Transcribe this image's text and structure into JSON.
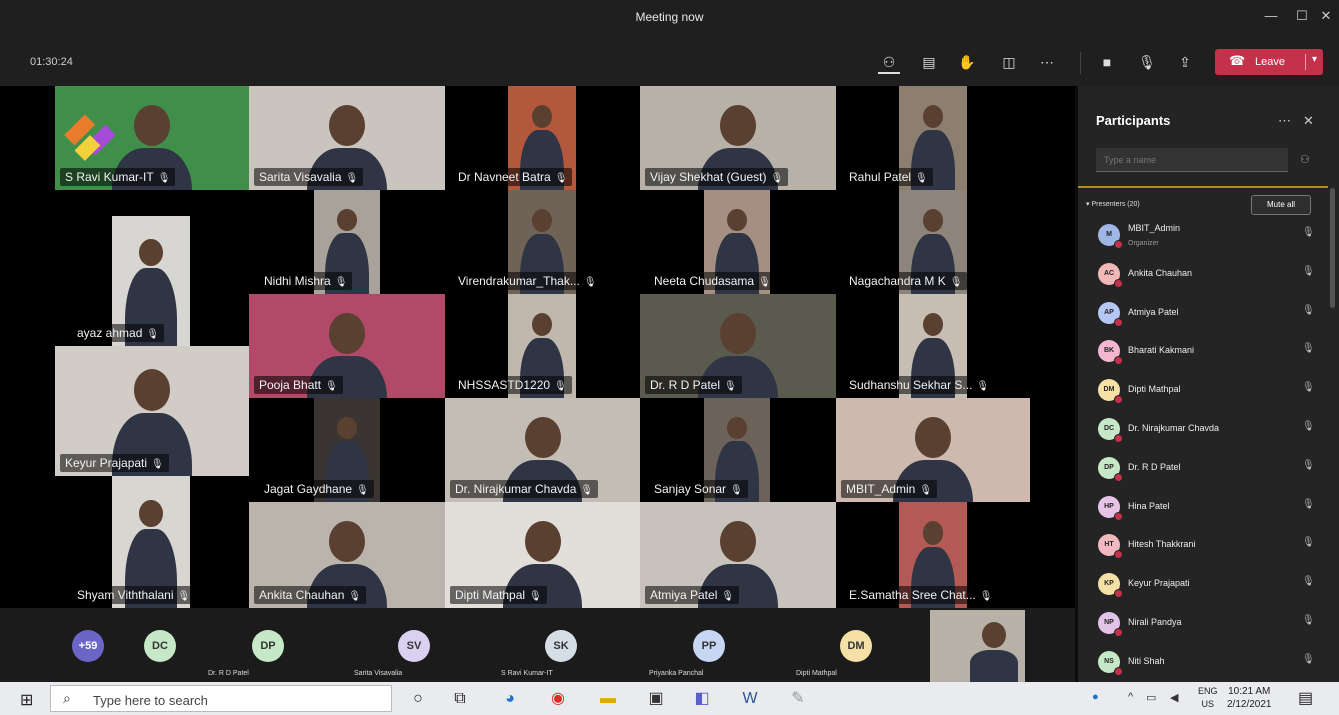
{
  "window": {
    "title": "Meeting now"
  },
  "toolbar": {
    "timer": "01:30:24",
    "leave_label": "Leave"
  },
  "tiles": [
    {
      "name": "S Ravi Kumar-IT",
      "bg": "#3f8f4a"
    },
    {
      "name": "Sarita Visavalia",
      "bg": "#c9c4bd"
    },
    {
      "name": "Dr Navneet Batra",
      "bg": "#b4583d"
    },
    {
      "name": "Vijay Shekhat (Guest)",
      "bg": "#b7b1a8"
    },
    {
      "name": "Rahul Patel",
      "bg": "#8d7f6f"
    },
    {
      "name": "ayaz ahmad",
      "bg": "#d8d6d2"
    },
    {
      "name": "Nidhi Mishra",
      "bg": "#a9a29a"
    },
    {
      "name": "Virendrakumar_Thak...",
      "bg": "#6f6257"
    },
    {
      "name": "Neeta Chudasama",
      "bg": "#a58f82"
    },
    {
      "name": "Nagachandra M K",
      "bg": "#8d847c"
    },
    {
      "name": "Keyur Prajapati",
      "bg": "#d1ccc6"
    },
    {
      "name": "Pooja Bhatt",
      "bg": "#b04a68"
    },
    {
      "name": "NHSSASTD1220",
      "bg": "#c1b8ad"
    },
    {
      "name": "Dr. R D Patel",
      "bg": "#5b5a4f"
    },
    {
      "name": "Sudhanshu Sekhar S...",
      "bg": "#c6bdb3"
    },
    {
      "name": "Jagat Gaydhane",
      "bg": "#3a3533"
    },
    {
      "name": "Dr. Nirajkumar Chavda",
      "bg": "#c3bdb6"
    },
    {
      "name": "Sanjay Sonar",
      "bg": "#6c625a"
    },
    {
      "name": "MBIT_Admin",
      "bg": "#cdb9ad"
    },
    {
      "name": "Shyam Viththalani",
      "bg": "#d9d5d0"
    },
    {
      "name": "Ankita Chauhan",
      "bg": "#bab4ad"
    },
    {
      "name": "Dipti Mathpal",
      "bg": "#e2dfdb"
    },
    {
      "name": "Atmiya Patel",
      "bg": "#c7c2bc"
    },
    {
      "name": "E.Samatha Sree Chat...",
      "bg": "#b25a53"
    }
  ],
  "strip": [
    {
      "initials": "+59",
      "label": "",
      "color": "#6b66c6"
    },
    {
      "initials": "DC",
      "label": "",
      "color": "#c7e8c7"
    },
    {
      "initials": "DP",
      "label": "Dr. R D Patel",
      "color": "#c7e8c7"
    },
    {
      "initials": "SV",
      "label": "Sarita Visavalia",
      "color": "#d9d1ef"
    },
    {
      "initials": "SK",
      "label": "S Ravi Kumar-IT",
      "color": "#d5dde6"
    },
    {
      "initials": "PP",
      "label": "Priyanka Panchal",
      "color": "#c7d6f2"
    },
    {
      "initials": "DM",
      "label": "Dipti Mathpal",
      "color": "#f5e0a5"
    }
  ],
  "panel": {
    "title": "Participants",
    "search_placeholder": "Type a name",
    "section": "Presenters (20)",
    "mute_all": "Mute all",
    "people": [
      {
        "initials": "M",
        "name": "MBIT_Admin",
        "role": "Organizer",
        "color": "#9fb7e6"
      },
      {
        "initials": "AC",
        "name": "Ankita Chauhan",
        "role": "",
        "color": "#f2b8b8"
      },
      {
        "initials": "AP",
        "name": "Atmiya Patel",
        "role": "",
        "color": "#b5c7f2"
      },
      {
        "initials": "BK",
        "name": "Bharati Kakmani",
        "role": "",
        "color": "#f3b7cf"
      },
      {
        "initials": "DM",
        "name": "Dipti Mathpal",
        "role": "",
        "color": "#f5e0a5"
      },
      {
        "initials": "DC",
        "name": "Dr. Nirajkumar Chavda",
        "role": "",
        "color": "#c7e8c7"
      },
      {
        "initials": "DP",
        "name": "Dr. R D Patel",
        "role": "",
        "color": "#c7e8c7"
      },
      {
        "initials": "HP",
        "name": "Hina Patel",
        "role": "",
        "color": "#e8c3e8"
      },
      {
        "initials": "HT",
        "name": "Hitesh Thakkrani",
        "role": "",
        "color": "#f2b8c0"
      },
      {
        "initials": "KP",
        "name": "Keyur Prajapati",
        "role": "",
        "color": "#f5e0a5"
      },
      {
        "initials": "NP",
        "name": "Nirali Pandya",
        "role": "",
        "color": "#e4c3e8"
      },
      {
        "initials": "NS",
        "name": "Niti Shah",
        "role": "",
        "color": "#c7e8c7"
      }
    ]
  },
  "taskbar": {
    "search_placeholder": "Type here to search",
    "lang_top": "ENG",
    "lang_bottom": "US",
    "time": "10:21 AM",
    "date": "2/12/2021"
  }
}
